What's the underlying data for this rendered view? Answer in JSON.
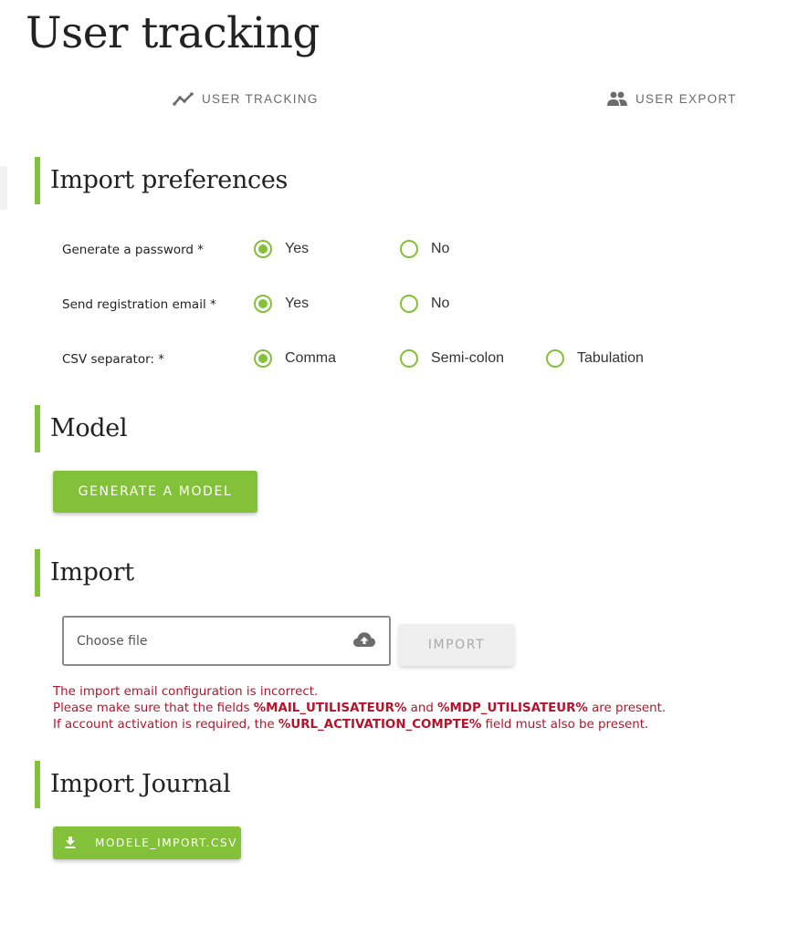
{
  "page": {
    "title": "User tracking"
  },
  "tabs": [
    {
      "label": "USER TRACKING",
      "icon": "trending-line-icon"
    },
    {
      "label": "USER EXPORT",
      "icon": "people-icon"
    }
  ],
  "colors": {
    "accent": "#84c13a",
    "error": "#b3142c",
    "tab_text": "#6b6b6b"
  },
  "sections": {
    "preferences": {
      "title": "Import preferences",
      "rows": [
        {
          "label": "Generate a password *",
          "options": [
            {
              "label": "Yes",
              "checked": true
            },
            {
              "label": "No",
              "checked": false
            }
          ]
        },
        {
          "label": "Send registration email *",
          "options": [
            {
              "label": "Yes",
              "checked": true
            },
            {
              "label": "No",
              "checked": false
            }
          ]
        },
        {
          "label": "CSV separator: *",
          "options": [
            {
              "label": "Comma",
              "checked": true
            },
            {
              "label": "Semi-colon",
              "checked": false
            },
            {
              "label": "Tabulation",
              "checked": false
            }
          ]
        }
      ]
    },
    "model": {
      "title": "Model",
      "button_label": "GENERATE A MODEL"
    },
    "import": {
      "title": "Import",
      "file_placeholder": "Choose file",
      "upload_icon": "cloud-upload-icon",
      "button_label": "IMPORT",
      "error": {
        "line1": "The import email configuration is incorrect.",
        "line2_prefix": "Please make sure that the fields ",
        "line2_field1": "%MAIL_UTILISATEUR%",
        "line2_mid": " and ",
        "line2_field2": "%MDP_UTILISATEUR%",
        "line2_suffix": " are present.",
        "line3_prefix": "If account activation is required, the ",
        "line3_field": "%URL_ACTIVATION_COMPTE%",
        "line3_suffix": " field must also be present."
      }
    },
    "journal": {
      "title": "Import Journal",
      "download_label": "MODELE_IMPORT.CSV",
      "download_icon": "download-icon"
    }
  }
}
